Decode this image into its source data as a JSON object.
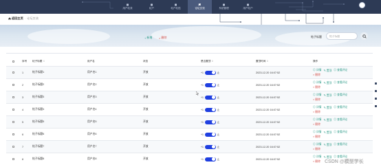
{
  "nav": {
    "items": [
      {
        "label": "用户帖录",
        "active": false
      },
      {
        "label": "帖户",
        "active": false
      },
      {
        "label": "帖户帖贴",
        "active": false
      },
      {
        "label": "论坛交流",
        "active": true
      },
      {
        "label": "系统管理",
        "active": false
      },
      {
        "label": "用户帖户",
        "active": false
      }
    ]
  },
  "breadcrumb": {
    "home": "返回主页",
    "separator": "·",
    "current": "论坛交流"
  },
  "toolbar": {
    "add_label": "新增",
    "delete_label": "删除"
  },
  "search": {
    "label": "帖子标题",
    "placeholder": "帖子标题"
  },
  "table": {
    "headers": {
      "no": "序号",
      "title": "帖子标题",
      "user": "用户名",
      "status": "状态",
      "top": "是否置顶",
      "time": "置顶时间",
      "ops": "操作"
    },
    "toggle_left": "+1",
    "toggle_right": "止",
    "ops": {
      "detail": "详情",
      "top": "置顶",
      "comment": "查看评论",
      "delete": "删除"
    },
    "rows": [
      {
        "no": "1",
        "title": "帖子标题1",
        "user": "用户名1",
        "status": "开放",
        "time": "2023-12-20 16:07:52"
      },
      {
        "no": "2",
        "title": "帖子标题2",
        "user": "用户名2",
        "status": "开放",
        "time": "2023-12-20 16:07:52"
      },
      {
        "no": "3",
        "title": "帖子标题3",
        "user": "用户名3",
        "status": "开放",
        "time": "2023-12-20 16:07:52"
      },
      {
        "no": "4",
        "title": "帖子标题4",
        "user": "用户名4",
        "status": "开放",
        "time": "2023-12-20 16:07:52"
      },
      {
        "no": "5",
        "title": "帖子标题5",
        "user": "用户名5",
        "status": "开放",
        "time": "2023-12-20 16:07:52"
      },
      {
        "no": "6",
        "title": "帖子标题6",
        "user": "用户名6",
        "status": "开放",
        "time": "2023-12-20 16:07:52"
      },
      {
        "no": "7",
        "title": "帖子标题7",
        "user": "用户名7",
        "status": "开放",
        "time": "2023-12-20 16:07:52"
      },
      {
        "no": "8",
        "title": "帖子标题8",
        "user": "用户名8",
        "status": "开放",
        "time": "2023-12-20 16:07:52"
      }
    ]
  },
  "watermark": "CSDN @模型学长",
  "colors": {
    "header": "#2d3a55",
    "active_nav": "#4a5a7c",
    "toggle": "#1f3fe0",
    "teal": "#2c9b88",
    "red": "#d4504a"
  }
}
